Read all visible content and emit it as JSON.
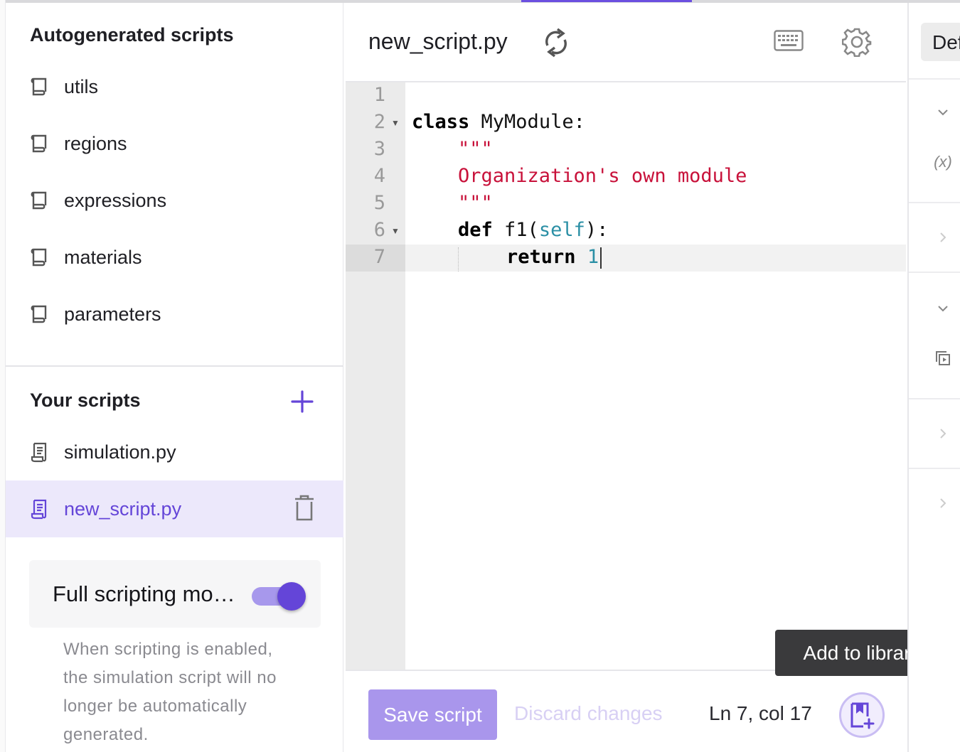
{
  "left_panel": {
    "autogen_title": "Autogenerated scripts",
    "autogen_items": [
      "utils",
      "regions",
      "expressions",
      "materials",
      "parameters"
    ],
    "your_title": "Your scripts",
    "your_items": [
      {
        "label": "simulation.py",
        "active": false
      },
      {
        "label": "new_script.py",
        "active": true
      }
    ],
    "full_scripting": {
      "label": "Full scripting mo…",
      "enabled": true,
      "help": "When scripting is enabled, the simulation script will no longer be automatically generated."
    }
  },
  "editor": {
    "file_title": "new_script.py",
    "line_numbers": [
      "1",
      "2",
      "3",
      "4",
      "5",
      "6",
      "7"
    ],
    "code": {
      "l2_kw": "class",
      "l2_rest": " MyModule:",
      "l3": "\"\"\"",
      "l4": "Organization's own module",
      "l5": "\"\"\"",
      "l6_kw": "def",
      "l6_name": " f1(",
      "l6_self": "self",
      "l6_end": "):",
      "l7_kw": "return",
      "l7_num": "1"
    },
    "save_label": "Save script",
    "discard_label": "Discard changes",
    "cursor_position": "Ln 7, col 17",
    "tooltip": "Add to library"
  },
  "right_rail": {
    "def_label": "Def",
    "icons": [
      "chevron-down-icon",
      "variable-icon",
      "chevron-right-icon",
      "chevron-down-icon",
      "copy-icon",
      "chevron-right-icon",
      "chevron-right-icon"
    ]
  },
  "colors": {
    "accent": "#6445d8",
    "accent_light": "#a996ec",
    "active_bg": "#ece8fb",
    "string": "#c8113a",
    "self": "#2a8fa5"
  }
}
